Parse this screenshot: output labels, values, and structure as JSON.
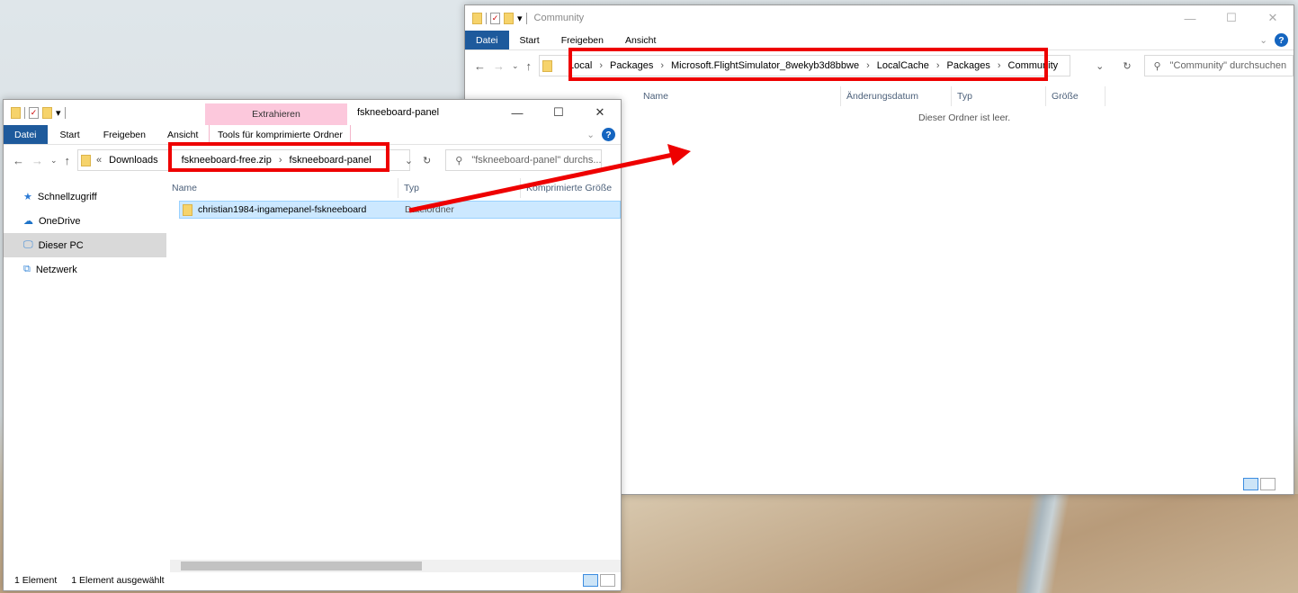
{
  "back_window": {
    "title": "Community",
    "ribbon_tabs": [
      "Datei",
      "Start",
      "Freigeben",
      "Ansicht"
    ],
    "path": [
      "Local",
      "Packages",
      "Microsoft.FlightSimulator_8wekyb3d8bbwe",
      "LocalCache",
      "Packages",
      "Community"
    ],
    "search_placeholder": "\"Community\" durchsuchen",
    "columns": [
      "Name",
      "Änderungsdatum",
      "Typ",
      "Größe"
    ],
    "empty_text": "Dieser Ordner ist leer.",
    "sidebar_partial": "Schnellzugriff"
  },
  "front_window": {
    "title": "fskneeboard-panel",
    "context_tab": "Extrahieren",
    "context_group": "Tools für komprimierte Ordner",
    "ribbon_tabs": [
      "Datei",
      "Start",
      "Freigeben",
      "Ansicht"
    ],
    "path_prefix": "Downloads",
    "path": [
      "fskneeboard-free.zip",
      "fskneeboard-panel"
    ],
    "search_placeholder": "\"fskneeboard-panel\" durchs...",
    "columns": [
      "Name",
      "Typ",
      "Komprimierte Größe"
    ],
    "sidebar": [
      {
        "label": "Schnellzugriff",
        "icon": "star-icon"
      },
      {
        "label": "OneDrive",
        "icon": "cloud-icon"
      },
      {
        "label": "Dieser PC",
        "icon": "computer-icon",
        "selected": true
      },
      {
        "label": "Netzwerk",
        "icon": "network-icon"
      }
    ],
    "files": [
      {
        "name": "christian1984-ingamepanel-fskneeboard",
        "type": "Dateiordner"
      }
    ],
    "status": {
      "count": "1 Element",
      "selected": "1 Element ausgewählt"
    }
  },
  "colors": {
    "accent": "#1e5a9c",
    "highlight": "#e00000",
    "selection": "#cce8ff"
  }
}
